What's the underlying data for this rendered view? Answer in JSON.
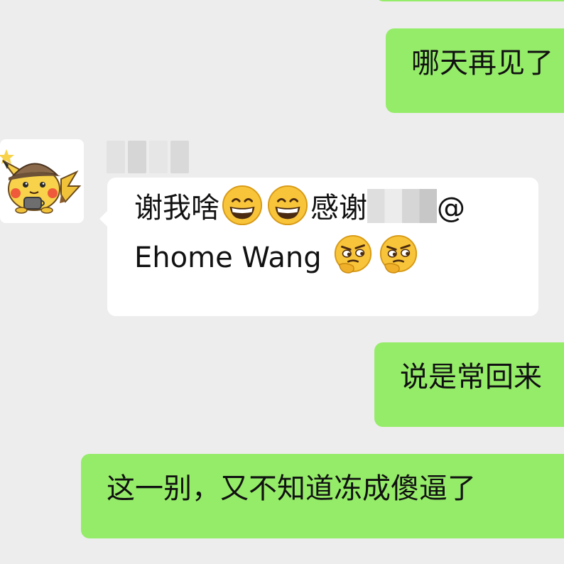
{
  "chat": {
    "messages": [
      {
        "id": "msg1",
        "direction": "outgoing",
        "text": "哪天再见了"
      },
      {
        "id": "msg2",
        "direction": "incoming",
        "sender": "",
        "line1_a": "谢我啥",
        "line1_b": "感谢",
        "line1_c": "@",
        "line2_a": "Ehome Wang ",
        "emoji_1": "grinning-face-icon",
        "emoji_2": "thinking-face-icon"
      },
      {
        "id": "msg3",
        "direction": "outgoing",
        "text": "说是常回来"
      },
      {
        "id": "msg4",
        "direction": "outgoing",
        "text": "这一别，又不知道冻成傻逼了"
      }
    ]
  },
  "colors": {
    "background": "#ededed",
    "outgoing_bubble": "#95ec69",
    "incoming_bubble": "#ffffff"
  }
}
